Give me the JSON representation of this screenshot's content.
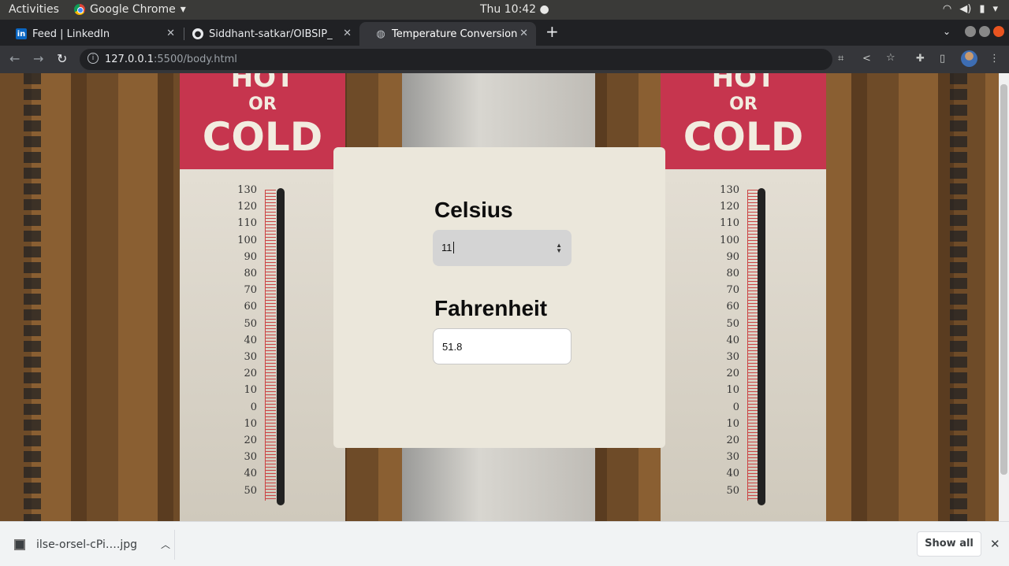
{
  "system_bar": {
    "activities": "Activities",
    "app_name": "Google Chrome",
    "clock": "Thu 10:42 ●"
  },
  "tabs": [
    {
      "label": "Feed | LinkedIn",
      "icon": "linkedin-icon",
      "active": false
    },
    {
      "label": "Siddhant-satkar/OIBSIP_",
      "icon": "github-icon",
      "active": false
    },
    {
      "label": "Temperature Conversion",
      "icon": "globe-icon",
      "active": true
    }
  ],
  "address_bar": {
    "host": "127.0.0.1",
    "path": ":5500/body.html"
  },
  "background": {
    "sign_top": "HOT",
    "sign_or": "OR",
    "sign_cold": "COLD",
    "scale": [
      "130",
      "120",
      "110",
      "100",
      "90",
      "80",
      "70",
      "60",
      "50",
      "40",
      "30",
      "20",
      "10",
      "0",
      "10",
      "20",
      "30",
      "40",
      "50"
    ]
  },
  "converter": {
    "celsius_label": "Celsius",
    "celsius_value": "11",
    "fahrenheit_label": "Fahrenheit",
    "fahrenheit_value": "51.8"
  },
  "download_bar": {
    "file_name": "ilse-orsel-cPi….jpg",
    "show_all": "Show all"
  }
}
